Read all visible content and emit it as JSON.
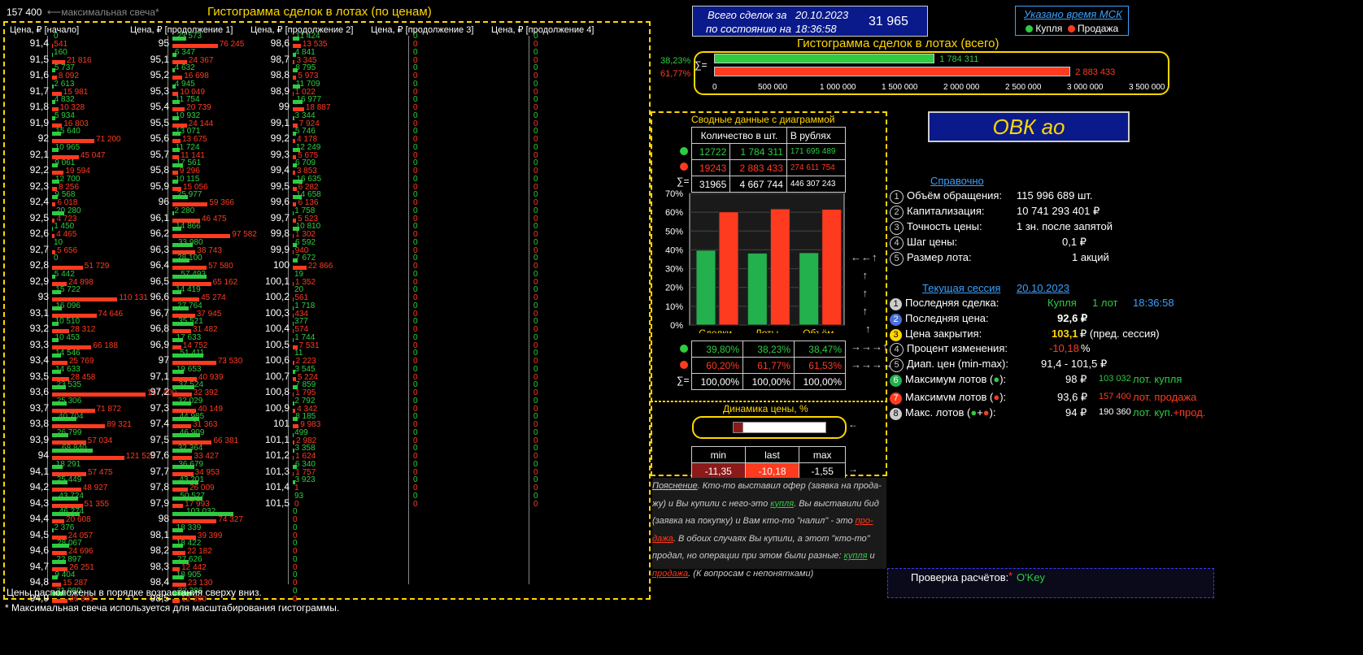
{
  "top": {
    "max_candle_value": "157 400",
    "max_candle_label": "максимальная свеча*"
  },
  "hist_title": "Гистограмма сделок в лотах (по ценам)",
  "hist_headers": [
    "Цена, ₽ [начало]",
    "Цена, ₽ [продолжение 1]",
    "Цена, ₽ [продолжение 2]",
    "Цена, ₽ [продолжение 3]",
    "Цена, ₽ [продолжение 4]"
  ],
  "hist_max": 157400,
  "hist_columns": [
    [
      {
        "p": "91,4",
        "g": 0,
        "r": 541
      },
      {
        "p": "91,5",
        "g": 160,
        "r": 21816
      },
      {
        "p": "91,6",
        "g": 5737,
        "r": 8092
      },
      {
        "p": "91,7",
        "g": 2613,
        "r": 15981
      },
      {
        "p": "91,8",
        "g": 4832,
        "r": 10328
      },
      {
        "p": "91,9",
        "g": 5934,
        "r": 16803
      },
      {
        "p": "92",
        "g": 15640,
        "r": 71200
      },
      {
        "p": "92,1",
        "g": 10965,
        "r": 45047
      },
      {
        "p": "92,2",
        "g": 9061,
        "r": 19594
      },
      {
        "p": "92,3",
        "g": 12700,
        "r": 8256
      },
      {
        "p": "92,4",
        "g": 9568,
        "r": 6018
      },
      {
        "p": "92,5",
        "g": 20280,
        "r": 4723
      },
      {
        "p": "92,6",
        "g": 1450,
        "r": 4465
      },
      {
        "p": "92,7",
        "g": 10,
        "r": 5656
      },
      {
        "p": "92,8",
        "g": 0,
        "r": 51729
      },
      {
        "p": "92,9",
        "g": 5442,
        "r": 24898
      },
      {
        "p": "93",
        "g": 15722,
        "r": 110131
      },
      {
        "p": "93,1",
        "g": 16096,
        "r": 74646
      },
      {
        "p": "93,2",
        "g": 10510,
        "r": 28312
      },
      {
        "p": "93,3",
        "g": 10453,
        "r": 66188
      },
      {
        "p": "93,4",
        "g": 14546,
        "r": 25769
      },
      {
        "p": "93,5",
        "g": 14633,
        "r": 28458
      },
      {
        "p": "93,6",
        "g": 23535,
        "r": 157400
      },
      {
        "p": "93,7",
        "g": 25306,
        "r": 71872
      },
      {
        "p": "93,8",
        "g": 40704,
        "r": 89321
      },
      {
        "p": "93,9",
        "g": 26799,
        "r": 57034
      },
      {
        "p": "94",
        "g": 68840,
        "r": 121520
      },
      {
        "p": "94,1",
        "g": 18291,
        "r": 57475
      },
      {
        "p": "94,2",
        "g": 25449,
        "r": 48927
      },
      {
        "p": "94,3",
        "g": 43724,
        "r": 51355
      },
      {
        "p": "94,4",
        "g": 46274,
        "r": 20608
      },
      {
        "p": "94,5",
        "g": 2376,
        "r": 24057
      },
      {
        "p": "94,6",
        "g": 28067,
        "r": 24696
      },
      {
        "p": "94,7",
        "g": 22897,
        "r": 26251
      },
      {
        "p": "94,8",
        "g": 9404,
        "r": 15287
      },
      {
        "p": "94,9",
        "g": 21080,
        "r": 26391
      }
    ],
    [
      {
        "p": "95",
        "g": 23573,
        "r": 76245
      },
      {
        "p": "95,1",
        "g": 6347,
        "r": 24367
      },
      {
        "p": "95,2",
        "g": 4632,
        "r": 16698
      },
      {
        "p": "95,3",
        "g": 4945,
        "r": 10049
      },
      {
        "p": "95,4",
        "g": 11754,
        "r": 20739
      },
      {
        "p": "95,5",
        "g": 10932,
        "r": 24144
      },
      {
        "p": "95,6",
        "g": 13071,
        "r": 13675
      },
      {
        "p": "95,7",
        "g": 11724,
        "r": 11141
      },
      {
        "p": "95,8",
        "g": 17561,
        "r": 9296
      },
      {
        "p": "95,9",
        "g": 10115,
        "r": 15056
      },
      {
        "p": "96",
        "g": 25977,
        "r": 59366
      },
      {
        "p": "96,1",
        "g": 2280,
        "r": 46475
      },
      {
        "p": "96,2",
        "g": 14866,
        "r": 97582
      },
      {
        "p": "96,3",
        "g": 33980,
        "r": 38743
      },
      {
        "p": "96,4",
        "g": 28100,
        "r": 57580
      },
      {
        "p": "96,5",
        "g": 57493,
        "r": 65162
      },
      {
        "p": "96,6",
        "g": 14419,
        "r": 45274
      },
      {
        "p": "96,7",
        "g": 27764,
        "r": 37945
      },
      {
        "p": "96,8",
        "g": 35521,
        "r": 31482
      },
      {
        "p": "96,9",
        "g": 17633,
        "r": 14752
      },
      {
        "p": "97",
        "g": 51411,
        "r": 73530
      },
      {
        "p": "97,1",
        "g": 19653,
        "r": 40939
      },
      {
        "p": "97,2",
        "g": 37524,
        "r": 32392
      },
      {
        "p": "97,3",
        "g": 32029,
        "r": 40149
      },
      {
        "p": "97,4",
        "g": 44985,
        "r": 31363
      },
      {
        "p": "97,5",
        "g": 46909,
        "r": 66381
      },
      {
        "p": "97,6",
        "g": 32364,
        "r": 33427
      },
      {
        "p": "97,7",
        "g": 36679,
        "r": 34953
      },
      {
        "p": "97,8",
        "g": 43201,
        "r": 26009
      },
      {
        "p": "97,9",
        "g": 50527,
        "r": 17993
      },
      {
        "p": "98",
        "g": 103032,
        "r": 74327
      },
      {
        "p": "98,1",
        "g": 18339,
        "r": 39399
      },
      {
        "p": "98,2",
        "g": 18422,
        "r": 22182
      },
      {
        "p": "98,3",
        "g": 27626,
        "r": 12442
      },
      {
        "p": "98,4",
        "g": 18905,
        "r": 23130
      },
      {
        "p": "98,5",
        "g": 32386,
        "r": 12390
      }
    ],
    [
      {
        "p": "98,6",
        "g": 11424,
        "r": 13535
      },
      {
        "p": "98,7",
        "g": 4841,
        "r": 3345
      },
      {
        "p": "98,8",
        "g": 8795,
        "r": 5973
      },
      {
        "p": "98,9",
        "g": 11709,
        "r": 1022
      },
      {
        "p": "99",
        "g": 16977,
        "r": 18887
      },
      {
        "p": "99,1",
        "g": 3344,
        "r": 7924
      },
      {
        "p": "99,2",
        "g": 5746,
        "r": 4178
      },
      {
        "p": "99,3",
        "g": 12249,
        "r": 5675
      },
      {
        "p": "99,4",
        "g": 6709,
        "r": 3853
      },
      {
        "p": "99,5",
        "g": 16635,
        "r": 6282
      },
      {
        "p": "99,6",
        "g": 14658,
        "r": 6136
      },
      {
        "p": "99,7",
        "g": 1758,
        "r": 5523
      },
      {
        "p": "99,8",
        "g": 10810,
        "r": 1302
      },
      {
        "p": "99,9",
        "g": 6592,
        "r": 940
      },
      {
        "p": "100",
        "g": 7672,
        "r": 22866
      },
      {
        "p": "100,1",
        "g": 19,
        "r": 1352
      },
      {
        "p": "100,2",
        "g": 20,
        "r": 561
      },
      {
        "p": "100,3",
        "g": 1718,
        "r": 434
      },
      {
        "p": "100,4",
        "g": 377,
        "r": 574
      },
      {
        "p": "100,5",
        "g": 1744,
        "r": 7531
      },
      {
        "p": "100,6",
        "g": 11,
        "r": 2223
      },
      {
        "p": "100,7",
        "g": 3545,
        "r": 5224
      },
      {
        "p": "100,8",
        "g": 7859,
        "r": 1795
      },
      {
        "p": "100,9",
        "g": 2792,
        "r": 4342
      },
      {
        "p": "101",
        "g": 8185,
        "r": 9983
      },
      {
        "p": "101,1",
        "g": 499,
        "r": 2982
      },
      {
        "p": "101,2",
        "g": 3358,
        "r": 1624
      },
      {
        "p": "101,3",
        "g": 6340,
        "r": 1757
      },
      {
        "p": "101,4",
        "g": 3923,
        "r": 1
      },
      {
        "p": "101,5",
        "g": 93,
        "r": 0
      }
    ]
  ],
  "empty_counts": [
    30,
    36,
    36
  ],
  "hist_footer": "Цены расположены в порядке возрастания сверху вниз.",
  "footnote": "* Максимальная свеча используется для масштабирования гистограммы.",
  "total_box": {
    "line1": "Всего сделок за",
    "date": "20.10.2023",
    "line2": "по состоянию на",
    "time": "18:36:58",
    "value": "31 965"
  },
  "legend_box": {
    "title": "Указано время МСК",
    "buy": "Купля",
    "sell": "Продажа"
  },
  "total_hist": {
    "title": "Гистограмма сделок в лотах (всего)",
    "buy_pct": "38,23%",
    "sell_pct": "61,77%",
    "sigma": "∑=",
    "buy_label": "1 784 311",
    "sell_label": "2 883 433",
    "buy": 1784311,
    "sell": 2883433,
    "xmax": 3500000,
    "ticks": [
      "0",
      "500 000",
      "1 000 000",
      "1 500 000",
      "2 000 000",
      "2 500 000",
      "3 000 000",
      "3 500 000"
    ]
  },
  "summary": {
    "title": "Сводные данные с диаграммой",
    "h_count": "Количество в шт.",
    "h_rub": "В рублях",
    "rows": [
      {
        "deals": "12722",
        "lots": "1 784 311",
        "rub": "171 695 489"
      },
      {
        "deals": "19243",
        "lots": "2 883 433",
        "rub": "274 611 754"
      },
      {
        "deals": "31965",
        "lots": "4 667 744",
        "rub": "446 307 243"
      }
    ],
    "sigma": "∑="
  },
  "chart_data": {
    "type": "bar",
    "categories": [
      "Сделки",
      "Лоты",
      "Объём"
    ],
    "series": [
      {
        "values": [
          39.8,
          38.23,
          38.47
        ],
        "color": "#22b14c"
      },
      {
        "values": [
          60.2,
          61.77,
          61.53
        ],
        "color": "#ff3b1f"
      }
    ],
    "ylim": [
      0,
      70
    ],
    "yticks": [
      "0%",
      "10%",
      "20%",
      "30%",
      "40%",
      "50%",
      "60%",
      "70%"
    ]
  },
  "pct_table": [
    [
      "39,80%",
      "38,23%",
      "38,47%"
    ],
    [
      "60,20%",
      "61,77%",
      "61,53%"
    ],
    [
      "100,00%",
      "100,00%",
      "100,00%"
    ]
  ],
  "dynamics": {
    "title": "Динамика цены, %",
    "h_min": "min",
    "h_last": "last",
    "h_max": "max",
    "min": "-11,35",
    "last": "-10,18",
    "max": "-1,55"
  },
  "ticker": "ОВК ао",
  "reference": {
    "title": "Справочно",
    "items": [
      {
        "n": "1",
        "label": "Объём обращения:",
        "value": "115 996 689 шт."
      },
      {
        "n": "2",
        "label": "Капитализация:",
        "value": "10 741 293 401 ₽"
      },
      {
        "n": "3",
        "label": "Точность цены:",
        "value": "1 зн. после запятой"
      },
      {
        "n": "4",
        "label": "Шаг цены:",
        "value": "0,1 ₽"
      },
      {
        "n": "5",
        "label": "Размер лота:",
        "value": "1  акций"
      }
    ]
  },
  "session": {
    "title": "Текущая сессия",
    "date": "20.10.2023",
    "last_deal": "Последняя сделка:",
    "last_deal_type": "Купля",
    "last_deal_lots": "1 лот",
    "last_deal_time": "18:36:58",
    "last_price_label": "Последняя цена:",
    "last_price": "92,6 ₽",
    "close_label": "Цена закрытия:",
    "close_price": "103,1",
    "close_note": "₽ (пред. сессия)",
    "change_label": "Процент  изменения:",
    "change_value": "-10,18",
    "change_unit": "%",
    "range_label": "Диап. цен (min-max):",
    "range_value": "91,4 - 101,5 ₽",
    "max_buy_label": "Максимум лотов (",
    "max_buy_price": "98 ₽",
    "max_buy_lots": "103 032",
    "max_buy_text": "лот. купля",
    "max_sell_label": "Максимvм лотов (",
    "max_sell_price": "93,6 ₽",
    "max_sell_lots": "157 400",
    "max_sell_text": "лот. продажа",
    "max_all_label": "Макс. лотов (",
    "max_all_price": "94 ₽",
    "max_all_lots": "190 360",
    "max_all_text1": "лот. куп.",
    "max_all_text2": "+прод."
  },
  "explanation": {
    "head": "Пояснение",
    "t1": ". Кто-то выставил офер (заявка на прода-жу) и Вы купили с него-это ",
    "buy1": "купля",
    "t2": ". Вы выставили бид (заявка на покупку) и Вам кто-то \"налил\" - это ",
    "sell1": "про-дажа",
    "t3": ". В обоих случаях Вы купили, а этот \"кто-то\" продал, но операции при этом были разные: ",
    "buy2": "купля",
    "t4": " и ",
    "sell2": "продажа",
    "t5": ". (К вопросам с непонятками)"
  },
  "check": {
    "label": "Проверка расчётов:",
    "star": "*",
    "value": "O'Key"
  }
}
